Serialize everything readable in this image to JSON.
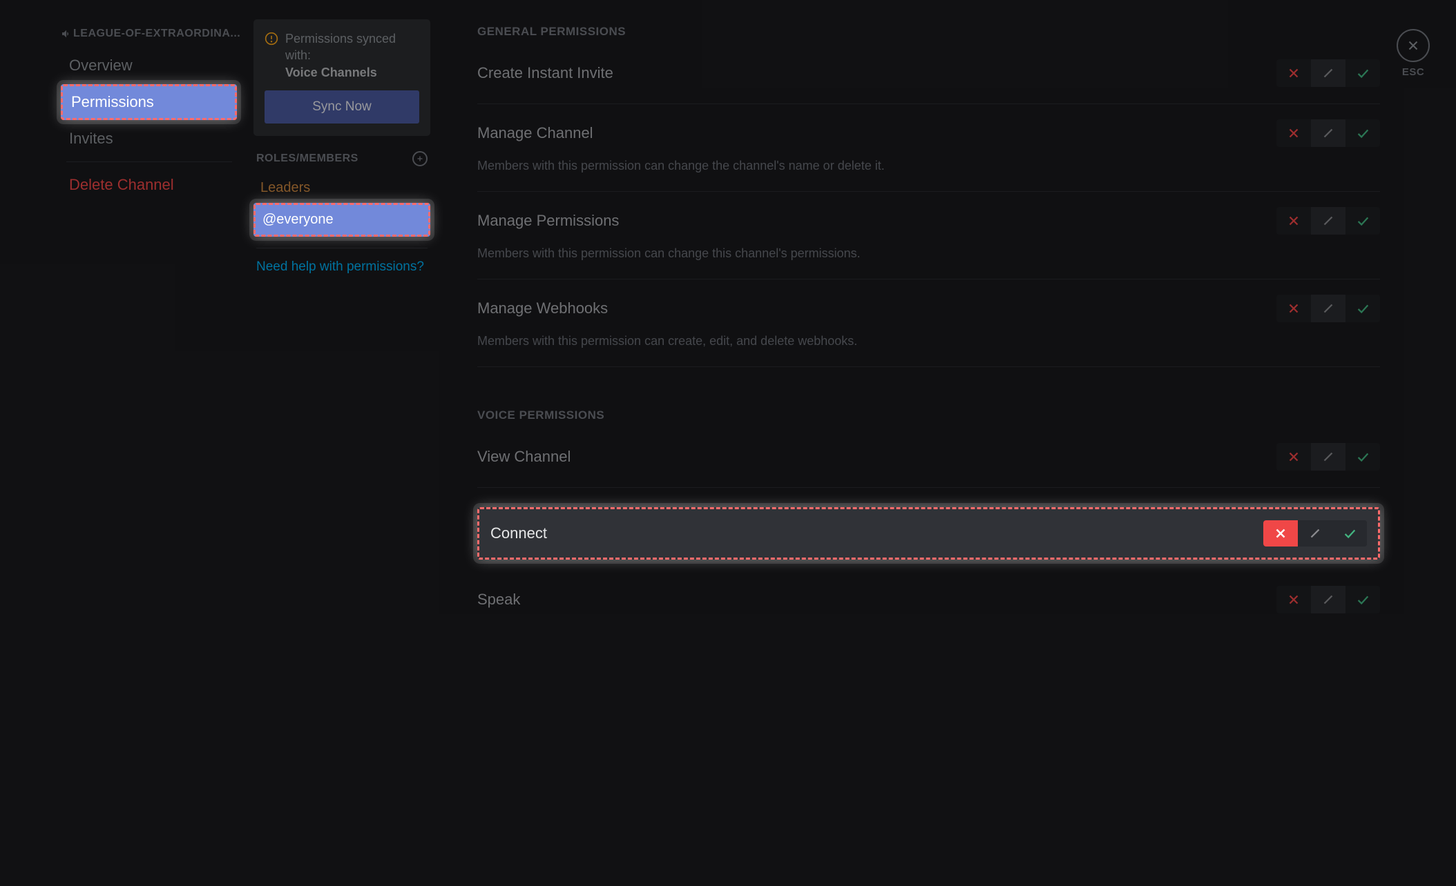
{
  "channel_name": "LEAGUE-OF-EXTRAORDINA...",
  "nav": {
    "overview": "Overview",
    "permissions": "Permissions",
    "invites": "Invites",
    "delete": "Delete Channel"
  },
  "sync": {
    "label": "Permissions synced with:",
    "category": "Voice Channels",
    "button": "Sync Now"
  },
  "roles_header": "ROLES/MEMBERS",
  "roles": {
    "leaders": "Leaders",
    "everyone": "@everyone"
  },
  "help_link": "Need help with permissions?",
  "sections": {
    "general": "GENERAL PERMISSIONS",
    "voice": "VOICE PERMISSIONS"
  },
  "perms": {
    "create_invite": {
      "title": "Create Instant Invite"
    },
    "manage_channel": {
      "title": "Manage Channel",
      "desc": "Members with this permission can change the channel's name or delete it."
    },
    "manage_permissions": {
      "title": "Manage Permissions",
      "desc": "Members with this permission can change this channel's permissions."
    },
    "manage_webhooks": {
      "title": "Manage Webhooks",
      "desc": "Members with this permission can create, edit, and delete webhooks."
    },
    "view_channel": {
      "title": "View Channel"
    },
    "connect": {
      "title": "Connect"
    },
    "speak": {
      "title": "Speak"
    }
  },
  "close": {
    "esc": "ESC"
  }
}
